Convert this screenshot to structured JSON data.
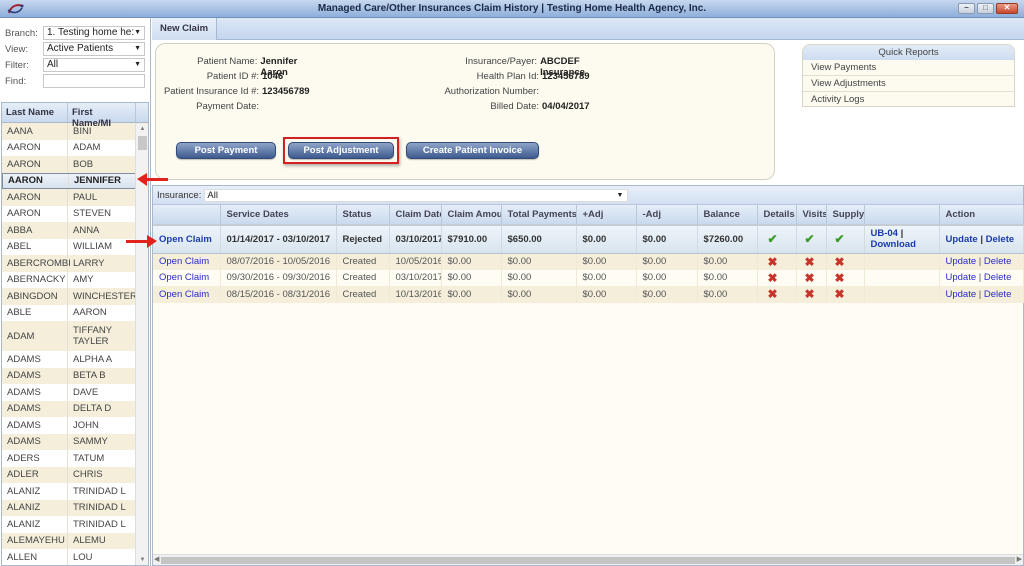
{
  "window": {
    "title": "Managed Care/Other Insurances Claim History | Testing Home Health Agency, Inc.",
    "controls": {
      "minimize": "–",
      "maximize": "□",
      "close": "✕"
    }
  },
  "sidebar": {
    "filters": {
      "branch_label": "Branch:",
      "branch_value": "1. Testing home he:",
      "view_label": "View:",
      "view_value": "Active Patients",
      "filter_label": "Filter:",
      "filter_value": "All",
      "find_label": "Find:",
      "find_value": ""
    },
    "columns": [
      "Last Name",
      "First Name/MI"
    ],
    "patients": [
      {
        "last": "AANA",
        "first": "BINI"
      },
      {
        "last": "AARON",
        "first": "ADAM"
      },
      {
        "last": "AARON",
        "first": "BOB"
      },
      {
        "last": "AARON",
        "first": "JENNIFER",
        "selected": true
      },
      {
        "last": "AARON",
        "first": "PAUL"
      },
      {
        "last": "AARON",
        "first": "STEVEN"
      },
      {
        "last": "ABBA",
        "first": "ANNA"
      },
      {
        "last": "ABEL",
        "first": "WILLIAM"
      },
      {
        "last": "ABERCROMBI",
        "first": "LARRY"
      },
      {
        "last": "ABERNACKY",
        "first": "AMY"
      },
      {
        "last": "ABINGDON",
        "first": "WINCHESTER"
      },
      {
        "last": "ABLE",
        "first": "AARON"
      },
      {
        "last": "ADAM",
        "first": "TIFFANY TAYLER"
      },
      {
        "last": "ADAMS",
        "first": "ALPHA A"
      },
      {
        "last": "ADAMS",
        "first": "BETA B"
      },
      {
        "last": "ADAMS",
        "first": "DAVE"
      },
      {
        "last": "ADAMS",
        "first": "DELTA D"
      },
      {
        "last": "ADAMS",
        "first": "JOHN"
      },
      {
        "last": "ADAMS",
        "first": "SAMMY"
      },
      {
        "last": "ADERS",
        "first": "TATUM"
      },
      {
        "last": "ADLER",
        "first": "CHRIS"
      },
      {
        "last": "ALANIZ",
        "first": "TRINIDAD L"
      },
      {
        "last": "ALANIZ",
        "first": "TRINIDAD L"
      },
      {
        "last": "ALANIZ",
        "first": "TRINIDAD L"
      },
      {
        "last": "ALEMAYEHU",
        "first": "ALEMU"
      },
      {
        "last": "ALLEN",
        "first": "LOU"
      }
    ]
  },
  "tabs": [
    {
      "label": "New Claim"
    }
  ],
  "patient_info": {
    "left": [
      {
        "label": "Patient Name:",
        "value": "Jennifer Aaron"
      },
      {
        "label": "Patient ID #:",
        "value": "1046"
      },
      {
        "label": "Patient Insurance Id #:",
        "value": "123456789"
      },
      {
        "label": "Payment Date:",
        "value": ""
      }
    ],
    "right": [
      {
        "label": "Insurance/Payer:",
        "value": "ABCDEF Insurance"
      },
      {
        "label": "Health Plan Id:",
        "value": "123456789"
      },
      {
        "label": "Authorization Number:",
        "value": ""
      },
      {
        "label": "Billed Date:",
        "value": "04/04/2017"
      }
    ]
  },
  "actions": {
    "post_payment": "Post Payment",
    "post_adjustment": "Post Adjustment",
    "create_invoice": "Create Patient Invoice"
  },
  "quick_reports": {
    "title": "Quick Reports",
    "items": [
      "View Payments",
      "View Adjustments",
      "Activity Logs"
    ]
  },
  "claims": {
    "insurance_label": "Insurance:",
    "insurance_value": "All",
    "columns": [
      "",
      "Service Dates",
      "Status",
      "Claim Date",
      "Claim Amoui",
      "Total Payments",
      "+Adj",
      "-Adj",
      "Balance",
      "Details",
      "Visits",
      "Supply",
      "",
      "Action"
    ],
    "rows": [
      {
        "open": "Open Claim",
        "service_dates": "01/14/2017 - 03/10/2017",
        "status": "Rejected",
        "claim_date": "03/10/2017",
        "claim_amount": "$7910.00",
        "total_payments": "$650.00",
        "plus_adj": "$0.00",
        "minus_adj": "$0.00",
        "balance": "$7260.00",
        "details": true,
        "visits": true,
        "supply": true,
        "ub04": "UB-04",
        "download": "Download",
        "update": "Update",
        "delete": "Delete"
      },
      {
        "open": "Open Claim",
        "service_dates": "08/07/2016 - 10/05/2016",
        "status": "Created",
        "claim_date": "10/05/2016",
        "claim_amount": "$0.00",
        "total_payments": "$0.00",
        "plus_adj": "$0.00",
        "minus_adj": "$0.00",
        "balance": "$0.00",
        "details": false,
        "visits": false,
        "supply": false,
        "ub04": "",
        "download": "",
        "update": "Update",
        "delete": "Delete"
      },
      {
        "open": "Open Claim",
        "service_dates": "09/30/2016 - 09/30/2016",
        "status": "Created",
        "claim_date": "03/10/2017",
        "claim_amount": "$0.00",
        "total_payments": "$0.00",
        "plus_adj": "$0.00",
        "minus_adj": "$0.00",
        "balance": "$0.00",
        "details": false,
        "visits": false,
        "supply": false,
        "ub04": "",
        "download": "",
        "update": "Update",
        "delete": "Delete"
      },
      {
        "open": "Open Claim",
        "service_dates": "08/15/2016 - 08/31/2016",
        "status": "Created",
        "claim_date": "10/13/2016",
        "claim_amount": "$0.00",
        "total_payments": "$0.00",
        "plus_adj": "$0.00",
        "minus_adj": "$0.00",
        "balance": "$0.00",
        "details": false,
        "visits": false,
        "supply": false,
        "ub04": "",
        "download": "",
        "update": "Update",
        "delete": "Delete"
      }
    ]
  },
  "icons": {
    "check": "✔",
    "cross": "✖",
    "dropdown": "▼",
    "scroll_up": "▲",
    "scroll_down": "▼",
    "scroll_left": "◀",
    "scroll_right": "▶"
  },
  "colors": {
    "accent": "#3e5b8f",
    "highlight": "#d32020",
    "ok": "#3a9a2a",
    "error": "#c8342a"
  }
}
